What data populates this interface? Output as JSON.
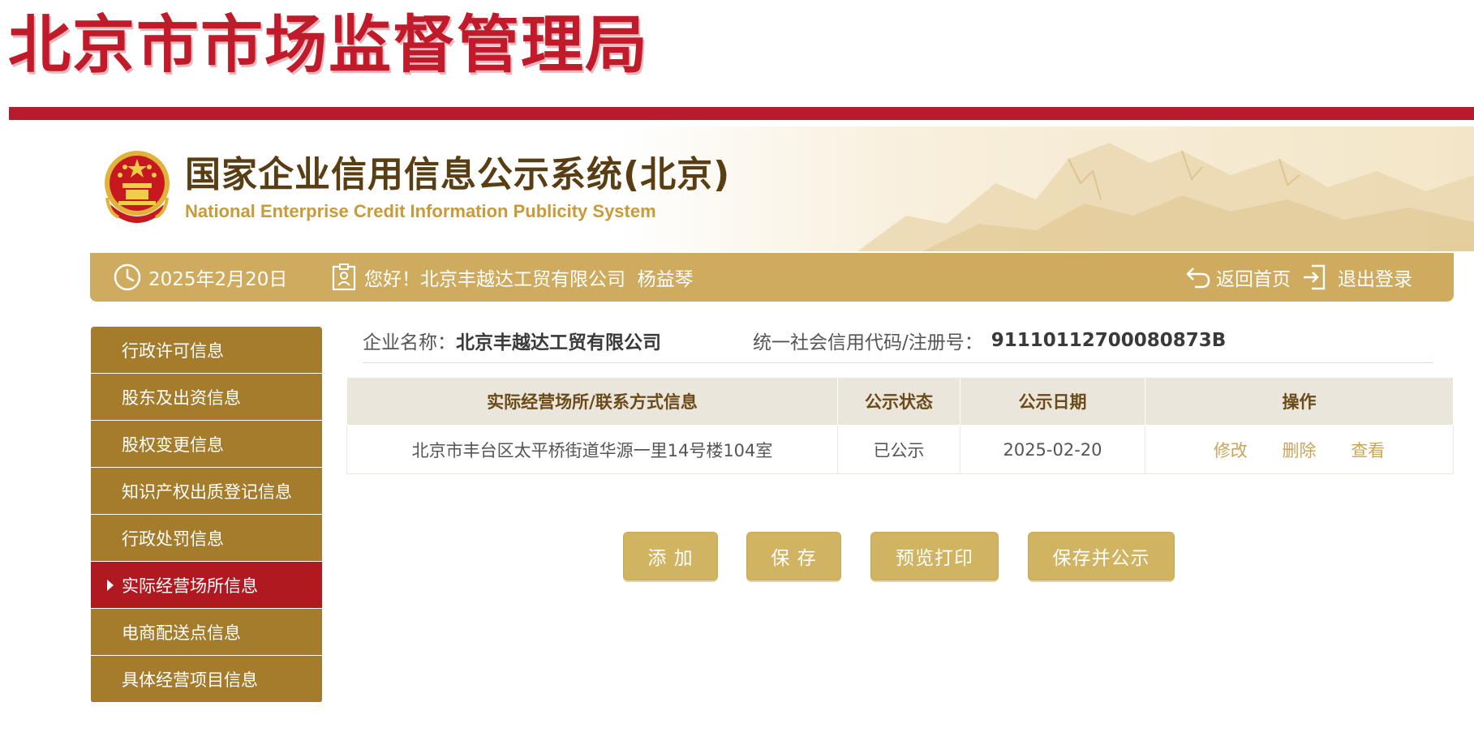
{
  "agency": {
    "title": "北京市市场监督管理局"
  },
  "system": {
    "title": "国家企业信用信息公示系统(北京)",
    "subtitle_en": "National Enterprise Credit Information Publicity System"
  },
  "info_bar": {
    "date": "2025年2月20日",
    "greeting": "您好！北京丰越达工贸有限公司  杨益琴",
    "home_link": "返回首页",
    "logout_link": "退出登录"
  },
  "sidebar": {
    "items": [
      {
        "label": "行政许可信息",
        "active": false
      },
      {
        "label": "股东及出资信息",
        "active": false
      },
      {
        "label": "股权变更信息",
        "active": false
      },
      {
        "label": "知识产权出质登记信息",
        "active": false
      },
      {
        "label": "行政处罚信息",
        "active": false
      },
      {
        "label": "实际经营场所信息",
        "active": true
      },
      {
        "label": "电商配送点信息",
        "active": false
      },
      {
        "label": "具体经营项目信息",
        "active": false
      }
    ]
  },
  "company": {
    "name_label": "企业名称：",
    "name": "北京丰越达工贸有限公司",
    "credit_code_label": "统一社会信用代码/注册号：",
    "credit_code": "91110112700080873B"
  },
  "table": {
    "headers": [
      "实际经营场所/联系方式信息",
      "公示状态",
      "公示日期",
      "操作"
    ],
    "rows": [
      {
        "address": "北京市丰台区太平桥街道华源一里14号楼104室",
        "status": "已公示",
        "date": "2025-02-20",
        "actions": [
          "修改",
          "删除",
          "查看"
        ]
      }
    ]
  },
  "buttons": {
    "add": "添 加",
    "save": "保 存",
    "preview_print": "预览打印",
    "save_publish": "保存并公示"
  },
  "colors": {
    "agency_red": "#c01a2b",
    "gold_bar": "#cfab5f",
    "sidebar_brown": "#a47c2c",
    "sidebar_active": "#b0191f",
    "button_gold": "#d1b462",
    "link_gold": "#c9a45a"
  },
  "icons": {
    "date": "clock-icon",
    "user": "id-card-icon",
    "home": "return-arrow-icon",
    "logout": "logout-icon",
    "emblem": "national-emblem-icon"
  }
}
